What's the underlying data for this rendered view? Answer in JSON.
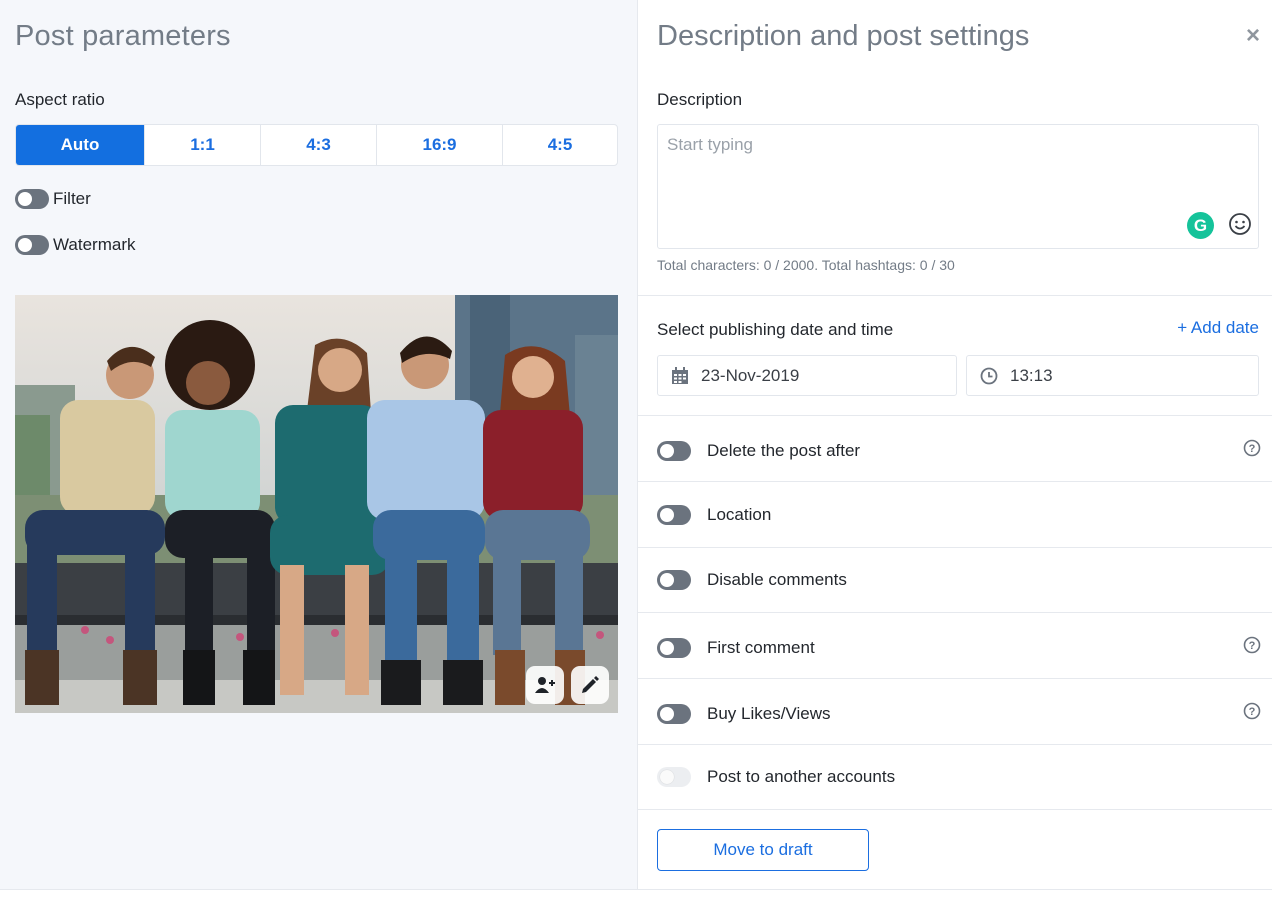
{
  "left": {
    "title": "Post parameters",
    "aspect_label": "Aspect ratio",
    "aspect_options": [
      "Auto",
      "1:1",
      "4:3",
      "16:9",
      "4:5"
    ],
    "aspect_selected": "Auto",
    "filter_label": "Filter",
    "watermark_label": "Watermark",
    "photo_buttons": [
      "tag-user-icon",
      "edit-pencil-icon"
    ]
  },
  "right": {
    "title": "Description and post settings",
    "close": "×",
    "description_label": "Description",
    "description_placeholder": "Start typing",
    "grammarly": "G",
    "counter": "Total characters: 0 / 2000. Total hashtags: 0 / 30",
    "publish_label": "Select publishing date and time",
    "add_date": "+ Add date",
    "date": "23-Nov-2019",
    "time": "13:13",
    "options": [
      {
        "label": "Delete the post after",
        "help": true
      },
      {
        "label": "Location",
        "help": false
      },
      {
        "label": "Disable comments",
        "help": false
      },
      {
        "label": "First comment",
        "help": true
      },
      {
        "label": "Buy Likes/Views",
        "help": true
      },
      {
        "label": "Post to another accounts",
        "help": false
      }
    ],
    "draft_button": "Move to draft"
  },
  "colors": {
    "accent": "#136fe0",
    "toggle_off": "#6b737e",
    "grammarly": "#15c39a"
  }
}
